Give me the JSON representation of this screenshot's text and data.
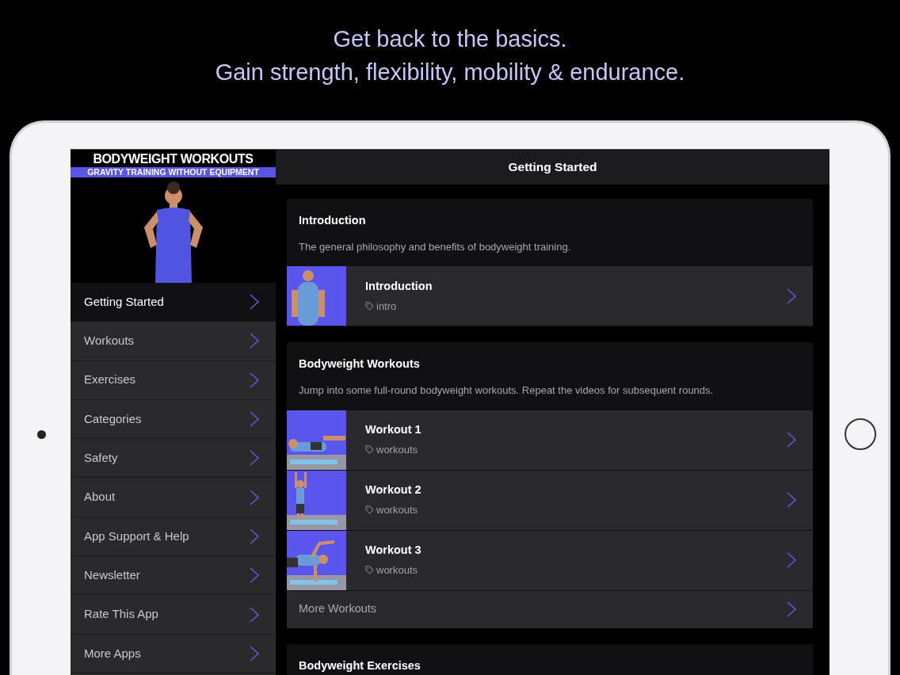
{
  "headline": [
    "Get back to the basics.",
    "Gain strength, flexibility, mobility & endurance."
  ],
  "sidebar": {
    "logo": {
      "title": "BODYWEIGHT WORKOUTS",
      "subtitle": "GRAVITY TRAINING WITHOUT EQUIPMENT"
    },
    "items": [
      {
        "label": "Getting Started",
        "selected": true
      },
      {
        "label": "Workouts",
        "selected": false
      },
      {
        "label": "Exercises",
        "selected": false
      },
      {
        "label": "Categories",
        "selected": false
      },
      {
        "label": "Safety",
        "selected": false
      },
      {
        "label": "About",
        "selected": false
      },
      {
        "label": "App Support & Help",
        "selected": false
      },
      {
        "label": "Newsletter",
        "selected": false
      },
      {
        "label": "Rate This App",
        "selected": false
      },
      {
        "label": "More Apps",
        "selected": false
      }
    ]
  },
  "main": {
    "title": "Getting Started",
    "sections": [
      {
        "title": "Introduction",
        "description": "The general philosophy and benefits of bodyweight training.",
        "rows": [
          {
            "title": "Introduction",
            "tag": "intro"
          }
        ]
      },
      {
        "title": "Bodyweight Workouts",
        "description": "Jump into some full-round bodyweight workouts. Repeat the videos for subsequent rounds.",
        "rows": [
          {
            "title": "Workout 1",
            "tag": "workouts"
          },
          {
            "title": "Workout 2",
            "tag": "workouts"
          },
          {
            "title": "Workout 3",
            "tag": "workouts"
          }
        ],
        "more": "More Workouts"
      },
      {
        "title": "Bodyweight Exercises"
      }
    ]
  }
}
